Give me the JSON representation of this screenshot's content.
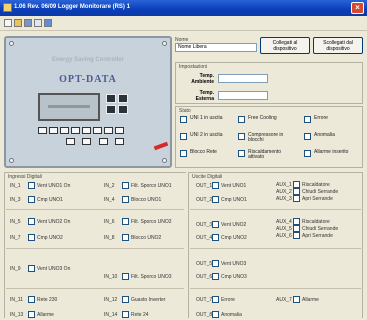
{
  "window": {
    "title": "1.06 Rev. 06/09 Logger Monitorare (RS) 1"
  },
  "close_glyph": "×",
  "device": {
    "title_line1": "Energy Saving Controller",
    "title_line2": "",
    "brand": "OPT-DATA"
  },
  "header": {
    "name_label": "Nome",
    "name_value": "Nome Libera",
    "btn_connect": "Collegati al dispositivo",
    "btn_disconnect": "Scollegati dal dispositivo"
  },
  "settings": {
    "section_label": "Impostazioni",
    "temp_ambient_label": "Temp. Ambiente",
    "temp_ambient_value": "",
    "temp_external_label": "Temp. Esterna",
    "temp_external_value": ""
  },
  "status": {
    "section_label": "Stato",
    "items": [
      {
        "label": "UNI 1 in uscita"
      },
      {
        "label": "Free Cooling"
      },
      {
        "label": "Errore"
      },
      {
        "label": "UNI 2 in uscita"
      },
      {
        "label": "Compressore in blocchi"
      },
      {
        "label": "Anomalia"
      },
      {
        "label": "Blocco Rete"
      },
      {
        "label": "Riscaldamento attivato"
      },
      {
        "label": "Allarme inserito"
      }
    ]
  },
  "digital": {
    "section_label": "Ingressi Digitali",
    "rows": [
      {
        "a_prefix": "IN_1",
        "a": "Vent UNO1 On",
        "b_prefix": "IN_2",
        "b": "Filt. Sporco UNO1"
      },
      {
        "a_prefix": "IN_3",
        "a": "Cmp UNO1",
        "b_prefix": "IN_4",
        "b": "Blocco UNO1"
      },
      {
        "a_prefix": "IN_5",
        "a": "Vent UNO2 On",
        "b_prefix": "IN_6",
        "b": "Filt. Sporco UNO2"
      },
      {
        "a_prefix": "IN_7",
        "a": "Cmp UNO2",
        "b_prefix": "IN_8",
        "b": "Blocco UNO2"
      },
      {
        "a_prefix": "IN_9",
        "a": "Vent UNO3 On",
        "b_prefix": "IN_10",
        "b": "Filt. Sporco UNO3"
      },
      {
        "a_prefix": "IN_11",
        "a": "Rete 230",
        "b_prefix": "IN_12",
        "b": "Guasto Inverter"
      },
      {
        "a_prefix": "IN_13",
        "a": "Allarme",
        "b_prefix": "IN_14",
        "b": "Rete 24"
      }
    ]
  },
  "outputs": {
    "section_label": "Uscite Digitali",
    "rows": [
      {
        "prefix": "OUT_1",
        "label": "Vent UNO1",
        "r_prefix": "AUX_1",
        "r": "Riscaldatore"
      },
      {
        "prefix": "OUT_2",
        "label": "Cmp UNO1",
        "r_prefix": "AUX_2",
        "r": "Chiudi Serrande"
      },
      {
        "prefix": "",
        "label": "",
        "r_prefix": "AUX_3",
        "r": "Apri Serrande"
      },
      {
        "prefix": "OUT_3",
        "label": "Vent UNO2",
        "r_prefix": "AUX_4",
        "r": "Riscaldatore"
      },
      {
        "prefix": "OUT_4",
        "label": "Cmp UNO2",
        "r_prefix": "AUX_5",
        "r": "Chiudi Serrande"
      },
      {
        "prefix": "",
        "label": "",
        "r_prefix": "AUX_6",
        "r": "Apri Serrande"
      },
      {
        "prefix": "OUT_5",
        "label": "Vent UNO3",
        "r_prefix": "",
        "r": ""
      },
      {
        "prefix": "OUT_6",
        "label": "Cmp UNO3",
        "r_prefix": "",
        "r": ""
      },
      {
        "prefix": "OUT_7",
        "label": "Errore",
        "r_prefix": "AUX_7",
        "r": "Allarme"
      },
      {
        "prefix": "OUT_8",
        "label": "Anomalia",
        "r_prefix": "",
        "r": ""
      }
    ]
  },
  "icons": {
    "toolbar": [
      "new-icon",
      "open-icon",
      "save-icon",
      "print-icon",
      "help-icon"
    ]
  },
  "colors": {
    "titlebar": "#0a3eb8",
    "window_bg": "#ece9d8",
    "device_bg": "#c8d2da",
    "brand": "#4a5a96",
    "close": "#d9482b"
  }
}
